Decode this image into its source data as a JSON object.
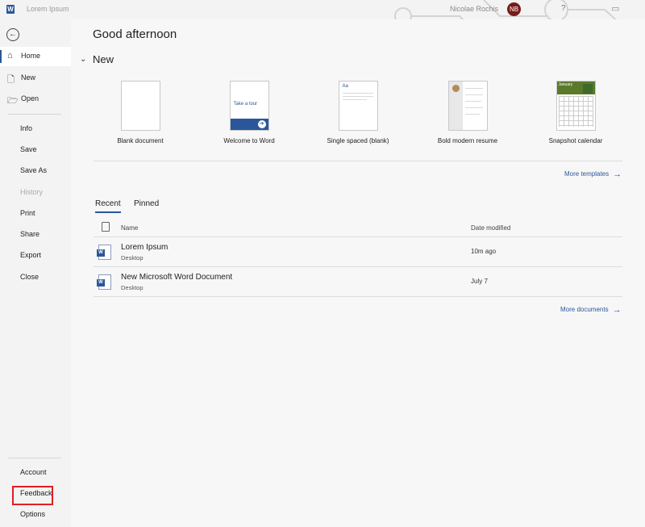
{
  "app": {
    "icon_letter": "W",
    "document_title": "Lorem Ipsum",
    "user_name": "Nicolae Rochis",
    "user_initials": "NB",
    "help_glyph": "?",
    "restore_glyph": "▭",
    "accent_color": "#2b579a",
    "avatar_color": "#7a1a1a"
  },
  "sidebar": {
    "back_icon": "arrow-left-icon",
    "items": [
      {
        "label": "Home",
        "icon": "home-icon",
        "active": true
      },
      {
        "label": "New",
        "icon": "new-document-icon"
      },
      {
        "label": "Open",
        "icon": "folder-icon"
      },
      {
        "label": "Info"
      },
      {
        "label": "Save"
      },
      {
        "label": "Save As"
      },
      {
        "label": "History",
        "disabled": true
      },
      {
        "label": "Print"
      },
      {
        "label": "Share"
      },
      {
        "label": "Export"
      },
      {
        "label": "Close"
      }
    ],
    "bottom_items": [
      {
        "label": "Account"
      },
      {
        "label": "Feedback"
      },
      {
        "label": "Options",
        "highlighted": true
      }
    ]
  },
  "main": {
    "greeting": "Good afternoon",
    "new_section_title": "New",
    "templates": [
      {
        "name": "Blank document"
      },
      {
        "name": "Welcome to Word",
        "thumb_text": "Take a tour"
      },
      {
        "name": "Single spaced (blank)",
        "thumb_text": "Aa"
      },
      {
        "name": "Bold modern resume"
      },
      {
        "name": "Snapshot calendar",
        "thumb_text": "January"
      }
    ],
    "more_templates": "More templates",
    "tabs": [
      {
        "label": "Recent",
        "active": true
      },
      {
        "label": "Pinned"
      }
    ],
    "columns": {
      "name": "Name",
      "date": "Date modified"
    },
    "files": [
      {
        "name": "Lorem Ipsum",
        "location": "Desktop",
        "date": "10m ago"
      },
      {
        "name": "New Microsoft Word Document",
        "location": "Desktop",
        "date": "July 7"
      }
    ],
    "more_documents": "More documents"
  }
}
